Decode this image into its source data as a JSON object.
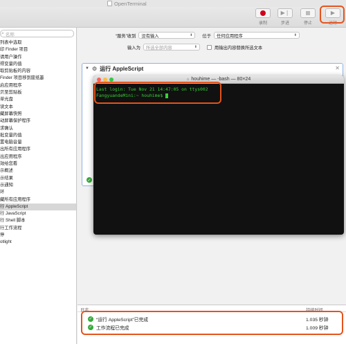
{
  "window": {
    "title": "OpenTerminal"
  },
  "toolbar": {
    "record_label": "录制",
    "step_label": "步进",
    "stop_label": "停止",
    "run_label": "运行"
  },
  "sidebar": {
    "search_placeholder": "名称",
    "items": [
      "列表中选取",
      "印 Finder 项目",
      "请用户操作",
      "得变量的值",
      "取剪贴板的内容",
      "Finder 项目移到废纸篓",
      "启应用程序",
      "贝至剪贴板",
      "单光盘",
      "读文本",
      "藏屏幕快照",
      "动屏幕保护程序",
      "求确认",
      "批变量的值",
      "置电脑音量",
      "出所有应用程序",
      "出应用程序",
      "效给您看",
      "示概述",
      "示结果",
      "示通知",
      "环",
      "藏所有应用程序",
      "行 AppleScript",
      "行 JavaScript",
      "行 Shell 脚本",
      "行工作流程",
      "停",
      "otlight"
    ],
    "selected_index": 23
  },
  "workflow": {
    "receives_label": "“服务”收到",
    "receives_value": "没有输入",
    "in_label": "位于",
    "in_value": "任何应用程序",
    "input_is_label": "输入为",
    "input_is_value": "所选全部内容",
    "replace_label": "用输出内容替换所选文本"
  },
  "action": {
    "title": "运行 AppleScript"
  },
  "terminal": {
    "title": "houhime — -bash — 80×24",
    "lines": [
      "Last login: Tue Nov 21 14:47:05 on ttys002",
      "FangyuandeMini:~ houhime$ "
    ]
  },
  "log": {
    "header_log": "日志",
    "header_duration": "持续时间",
    "rows": [
      {
        "text": "“运行 AppleScript”已完成",
        "duration": "1.035 秒钟"
      },
      {
        "text": "工作流程已完成",
        "duration": "1.009 秒钟"
      }
    ]
  },
  "colors": {
    "highlight": "#e5531c",
    "terminal_text": "#36d236",
    "terminal_bg": "#111111",
    "success": "#37a93a",
    "record": "#d0021b"
  }
}
